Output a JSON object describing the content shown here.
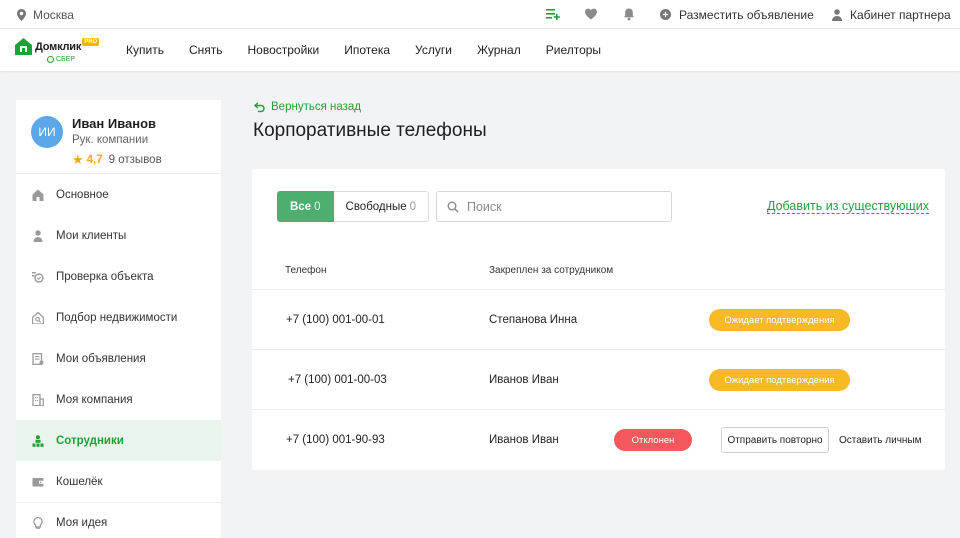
{
  "topbar": {
    "city": "Москва",
    "place_ad": "Разместить объявление",
    "partner_cabinet": "Кабинет партнера"
  },
  "logo": {
    "brand": "Домклик",
    "pro": "PRO",
    "sber": "СБЕР"
  },
  "nav": [
    "Купить",
    "Снять",
    "Новостройки",
    "Ипотека",
    "Услуги",
    "Журнал",
    "Риелторы"
  ],
  "profile": {
    "initials": "ИИ",
    "name": "Иван Иванов",
    "role": "Рук. компании",
    "rating": "4,7",
    "reviews": "9 отзывов"
  },
  "menu": [
    {
      "label": "Основное",
      "icon": "home-icon"
    },
    {
      "label": "Мои клиенты",
      "icon": "person-icon"
    },
    {
      "label": "Проверка объекта",
      "icon": "check-object-icon"
    },
    {
      "label": "Подбор недвижимости",
      "icon": "house-search-icon"
    },
    {
      "label": "Мои объявления",
      "icon": "listing-icon"
    },
    {
      "label": "Моя компания",
      "icon": "building-icon"
    },
    {
      "label": "Сотрудники",
      "icon": "employees-icon",
      "active": true
    },
    {
      "label": "Кошелёк",
      "icon": "wallet-icon"
    },
    {
      "label": "Моя идея",
      "icon": "idea-icon"
    }
  ],
  "main": {
    "back_label": "Вернуться назад",
    "title": "Корпоративные телефоны",
    "filters": {
      "all_label": "Все",
      "all_count": "0",
      "free_label": "Свободные",
      "free_count": "0"
    },
    "search_placeholder": "Поиск",
    "add_link": "Добавить из существующих",
    "columns": {
      "phone": "Телефон",
      "assigned": "Закреплен за сотрудником"
    },
    "rows": [
      {
        "phone": "+7 (100) 001-00-01",
        "employee": "Степанова Инна",
        "status": "Ожидает подтверждения"
      },
      {
        "phone": "+7 (100) 001-00-03",
        "employee": "Иванов Иван",
        "status": "Ожидает подтверждения"
      },
      {
        "phone": "+7 (100) 001-90-93",
        "employee": "Иванов Иван",
        "status": "Отклонен",
        "resend_label": "Отправить повторно",
        "keep_label": "Оставить личным"
      }
    ]
  },
  "colors": {
    "accent_green": "#21a038",
    "pending_yellow": "#f7b924",
    "rejected_red": "#f4575c",
    "avatar_blue": "#5ca7e8"
  }
}
